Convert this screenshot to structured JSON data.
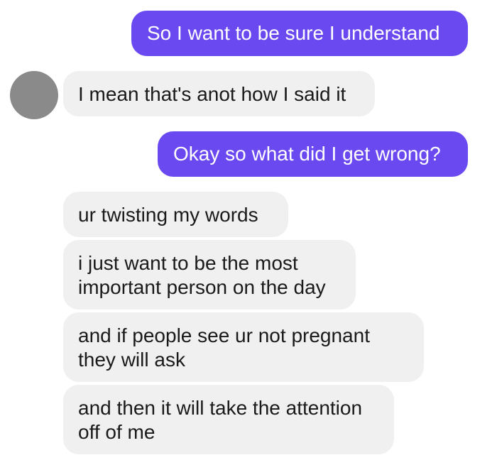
{
  "conversation": {
    "messages": [
      {
        "sender": "me",
        "lines": [
          "So I want to be sure I understand"
        ]
      },
      {
        "sender": "them",
        "lines": [
          "I mean that's anot how I said it"
        ]
      },
      {
        "sender": "me",
        "lines": [
          "Okay so what did I get wrong?"
        ]
      },
      {
        "sender": "them",
        "lines": [
          "ur twisting my words"
        ]
      },
      {
        "sender": "them",
        "lines": [
          "i just want to be the most",
          "important person on the day"
        ]
      },
      {
        "sender": "them",
        "lines": [
          "and if people see ur not pregnant",
          "they will ask"
        ]
      },
      {
        "sender": "them",
        "lines": [
          "and then it will take the attention",
          "off of me"
        ]
      }
    ]
  },
  "colors": {
    "sent_bubble": "#6a49f0",
    "received_bubble": "#f0f0f0",
    "avatar": "#8a8a8a",
    "background": "#ffffff"
  },
  "icons": {
    "avatar": "contact-avatar-placeholder"
  }
}
